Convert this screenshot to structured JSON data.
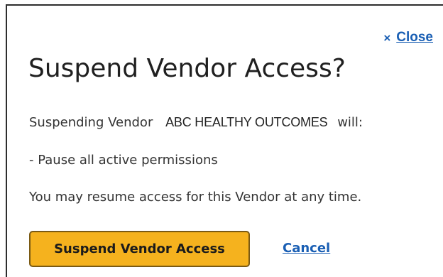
{
  "dialog": {
    "close_icon": "×",
    "close_label": "Close",
    "title": "Suspend Vendor Access?",
    "body": {
      "intro_prefix": "Suspending Vendor",
      "vendor_name": "ABC HEALTHY OUTCOMES",
      "intro_suffix": "will:",
      "bullet": "- Pause all active permissions",
      "note": "You may resume access for this Vendor at any time."
    },
    "primary_button_label": "Suspend Vendor Access",
    "cancel_label": "Cancel"
  },
  "colors": {
    "accent_link": "#1a5fb4",
    "primary_button": "#f5b21e",
    "primary_button_border": "#7a5a14"
  },
  "icons": {
    "close": "close-x-icon"
  }
}
